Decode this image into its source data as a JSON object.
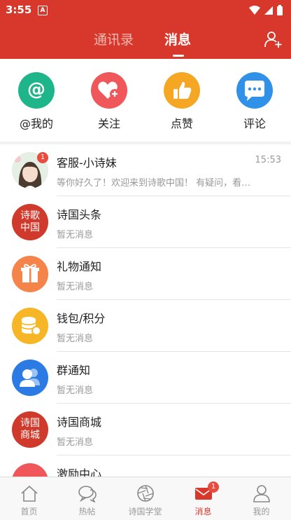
{
  "status_bar": {
    "time": "3:55",
    "app_icon": "A"
  },
  "header": {
    "tabs": [
      {
        "label": "通讯录",
        "active": false
      },
      {
        "label": "消息",
        "active": true
      }
    ],
    "add_friend_icon": "add-person-icon"
  },
  "quick_actions": [
    {
      "label": "@我的",
      "icon": "at-icon",
      "color": "#1fb58a"
    },
    {
      "label": "关注",
      "icon": "heart-plus-icon",
      "color": "#f0575a"
    },
    {
      "label": "点赞",
      "icon": "thumbs-up-icon",
      "color": "#f5a623"
    },
    {
      "label": "评论",
      "icon": "comment-icon",
      "color": "#2f91e8"
    }
  ],
  "messages": [
    {
      "title": "客服-小诗妹",
      "subtitle": "等你好久了！欢迎来到诗歌中国！ 有疑问，看…",
      "time": "15:53",
      "badge": "1"
    },
    {
      "title": "诗国头条",
      "subtitle": "暂无消息",
      "seal_line1": "诗歌",
      "seal_line2": "中国"
    },
    {
      "title": "礼物通知",
      "subtitle": "暂无消息"
    },
    {
      "title": "钱包/积分",
      "subtitle": "暂无消息"
    },
    {
      "title": "群通知",
      "subtitle": "暂无消息"
    },
    {
      "title": "诗国商城",
      "subtitle": "暂无消息",
      "seal_line1": "诗国",
      "seal_line2": "商城"
    },
    {
      "title": "激励中心",
      "subtitle": ""
    }
  ],
  "tabbar": [
    {
      "label": "首页",
      "icon": "home-icon"
    },
    {
      "label": "热帖",
      "icon": "chat-bubbles-icon"
    },
    {
      "label": "诗国学堂",
      "icon": "aperture-icon"
    },
    {
      "label": "消息",
      "icon": "envelope-icon",
      "active": true,
      "badge": "1"
    },
    {
      "label": "我的",
      "icon": "person-icon"
    }
  ],
  "colors": {
    "brand_red": "#d7382b",
    "badge_red": "#e94b3c"
  }
}
